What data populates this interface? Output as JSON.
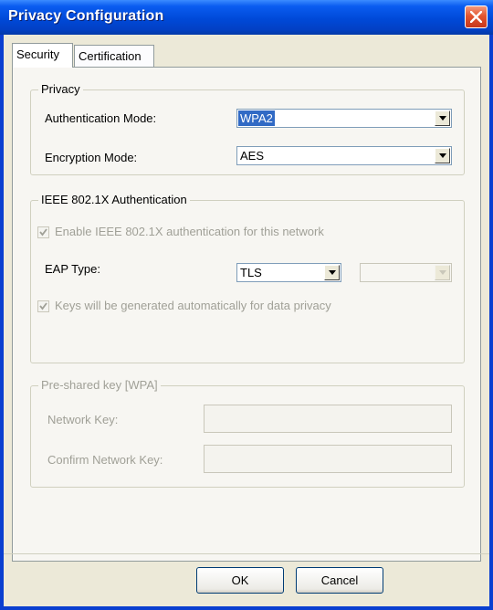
{
  "window": {
    "title": "Privacy Configuration"
  },
  "tabs": [
    {
      "label": "Security",
      "active": true
    },
    {
      "label": "Certification",
      "active": false
    }
  ],
  "privacy": {
    "legend": "Privacy",
    "auth_mode_label": "Authentication Mode:",
    "auth_mode_value": "WPA2",
    "enc_mode_label": "Encryption Mode:",
    "enc_mode_value": "AES"
  },
  "ieee": {
    "legend": "IEEE 802.1X Authentication",
    "enable_label": "Enable IEEE 802.1X authentication for this network",
    "enable_checked": true,
    "eap_label": "EAP Type:",
    "eap_value": "TLS",
    "eap_sub_value": "",
    "keys_label": "Keys will be generated automatically for data privacy",
    "keys_checked": true
  },
  "psk": {
    "legend": "Pre-shared key [WPA]",
    "network_key_label": "Network Key:",
    "network_key_value": "",
    "confirm_key_label": "Confirm Network Key:",
    "confirm_key_value": ""
  },
  "buttons": {
    "ok": "OK",
    "cancel": "Cancel"
  },
  "colors": {
    "titlebar": "#0049d8",
    "selection": "#316ac5",
    "close": "#e2552f",
    "dialog_bg": "#ece9d8"
  }
}
